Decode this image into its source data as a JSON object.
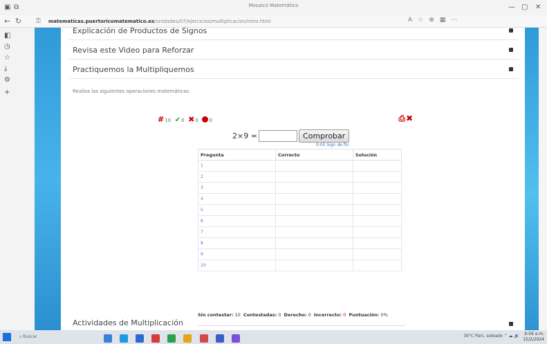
{
  "browser": {
    "title": "Mosaico Matemático",
    "url_host": "matematicas.puertoricomatematico.es",
    "url_path": "/unidades/07/ejercicios/multiplicacion/intro.html",
    "tab_controls": [
      "—",
      "▢",
      "✕"
    ]
  },
  "accordion": {
    "item1": "Explicación de Productos de Signos",
    "item2": "Revisa este Video para Reforzar",
    "item3": "Practiquemos la Multipliquemos",
    "item_last": "Actividades de Multiplicación"
  },
  "instructions": "Realiza las siguientes operaciones matemáticas.",
  "quiz": {
    "stats": {
      "total": "10",
      "correct": "0",
      "incorrect": "0",
      "skipped": "0"
    },
    "question": "2×9 =",
    "answer_placeholder": "",
    "check_label": "Comprobar",
    "time_link": "0:00 Sign de fin",
    "columns": [
      "Pregunta",
      "Correcto",
      "Solución"
    ],
    "rows": [
      {
        "n": "1",
        "correct": "",
        "solution": ""
      },
      {
        "n": "2",
        "correct": "",
        "solution": ""
      },
      {
        "n": "3",
        "correct": "",
        "solution": ""
      },
      {
        "n": "4",
        "correct": "",
        "solution": ""
      },
      {
        "n": "5",
        "correct": "",
        "solution": ""
      },
      {
        "n": "6",
        "correct": "",
        "solution": ""
      },
      {
        "n": "7",
        "correct": "",
        "solution": ""
      },
      {
        "n": "8",
        "correct": "",
        "solution": ""
      },
      {
        "n": "9",
        "correct": "",
        "solution": ""
      },
      {
        "n": "10",
        "correct": "",
        "solution": ""
      }
    ],
    "summary": {
      "unanswered_label": "Sin contestar:",
      "unanswered": "10",
      "answered_label": "Contestadas:",
      "answered": "0",
      "right_label": "Derecho:",
      "right": "0",
      "wrong_label": "Incorrecto:",
      "wrong": "0",
      "score_label": "Puntuación:",
      "score": "0%"
    }
  },
  "taskbar": {
    "search": "Buscar",
    "tray": "30°C Parc. soleado",
    "time": "9:56 a.m.",
    "date": "15/2/2024"
  },
  "colors": {
    "accent_blue": "#2f9ad9",
    "error_red": "#cc0000",
    "ok_green": "#2a9a2a",
    "link_blue": "#4a78c9"
  }
}
